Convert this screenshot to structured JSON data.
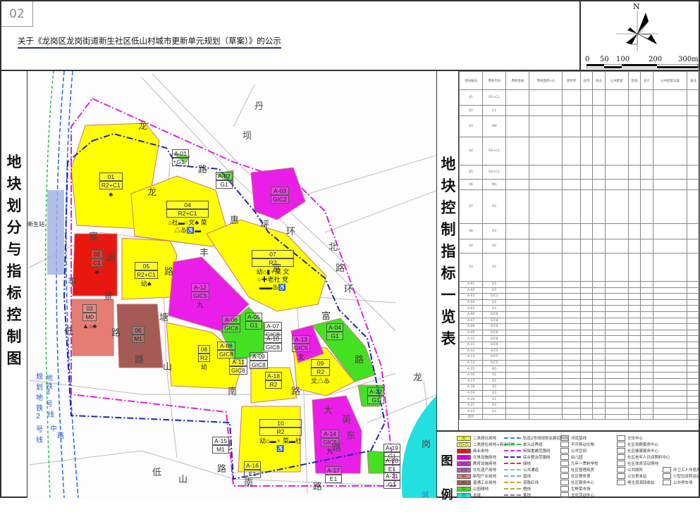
{
  "header": {
    "number": "02",
    "title": "关于《龙岗区龙岗街道新生社区低山村城市更新单元规划（草案）》的公示"
  },
  "compass": {
    "north": "N",
    "scale": [
      "0",
      "50",
      "100",
      "200",
      "300m"
    ]
  },
  "map": {
    "side_title": [
      "地",
      "块",
      "划",
      "分",
      "与",
      "指",
      "标",
      "控",
      "制",
      "图"
    ],
    "station": "新生站",
    "metro_labels": [
      "规",
      "划",
      "地",
      "铁",
      "2",
      "号",
      "线"
    ],
    "roads": [
      {
        "t": "丹"
      },
      {
        "t": "坝"
      },
      {
        "t": "龙"
      },
      {
        "t": "路"
      },
      {
        "t": "龙"
      },
      {
        "t": "惠"
      },
      {
        "t": "坪"
      },
      {
        "t": "富"
      },
      {
        "t": "源"
      },
      {
        "t": "环"
      },
      {
        "t": "北"
      },
      {
        "t": "富"
      },
      {
        "t": "路"
      },
      {
        "t": "丰"
      },
      {
        "t": "路"
      },
      {
        "t": "平"
      },
      {
        "t": "景"
      },
      {
        "t": "路"
      },
      {
        "t": "塘"
      },
      {
        "t": "路"
      },
      {
        "t": "环"
      },
      {
        "t": "富"
      },
      {
        "t": "路"
      },
      {
        "t": "低"
      },
      {
        "t": "山"
      },
      {
        "t": "南"
      },
      {
        "t": "路"
      },
      {
        "t": "大"
      },
      {
        "t": "英"
      },
      {
        "t": "东"
      },
      {
        "t": "路"
      },
      {
        "t": "路"
      },
      {
        "t": "低"
      },
      {
        "t": "山"
      },
      {
        "t": "南"
      },
      {
        "t": "路"
      },
      {
        "t": "龙"
      },
      {
        "t": "岗"
      },
      {
        "t": "河"
      },
      {
        "t": "地"
      },
      {
        "t": "铁"
      },
      {
        "t": "3"
      },
      {
        "t": "号"
      },
      {
        "t": "线"
      },
      {
        "t": "中"
      },
      {
        "t": "路"
      }
    ],
    "parcels": [
      {
        "id": "01",
        "code": "R2+C1",
        "fac": "♣"
      },
      {
        "id": "02",
        "code": "C1",
        "fac": "♣"
      },
      {
        "id": "03",
        "code": "M0",
        "fac": "▲⌂♣"
      },
      {
        "id": "04",
        "code": "R2+C1",
        "fac": "⌂社▬○文♣ 菜△♨♿▬"
      },
      {
        "id": "05",
        "code": "R2+C1",
        "fac": "幼♣"
      },
      {
        "id": "06",
        "code": "M1",
        "fac": ""
      },
      {
        "id": "07",
        "code": "R2",
        "fac": "幼⌂▮♆菜 文○✚老社 党▬▬♨♿"
      },
      {
        "id": "08",
        "code": "R2",
        "fac": "幼"
      },
      {
        "id": "09",
        "code": "R2",
        "fac": "文△♨"
      },
      {
        "id": "10",
        "code": "R2",
        "fac": "幼⌂▬♆ 菜▬社♿"
      },
      {
        "id": "A-01",
        "code": "G1"
      },
      {
        "id": "A-02",
        "code": "G1"
      },
      {
        "id": "A-03",
        "code": "GIC2"
      },
      {
        "id": "A-04",
        "code": "G1"
      },
      {
        "id": "A-05",
        "code": "G1"
      },
      {
        "id": "A-06",
        "code": "GIC8"
      },
      {
        "id": "A-07",
        "code": "GIC8"
      },
      {
        "id": "A-08",
        "code": "GIC8"
      },
      {
        "id": "A-09",
        "code": "GIC8"
      },
      {
        "id": "A-10",
        "code": "GIC8"
      },
      {
        "id": "A-11",
        "code": "GIC8"
      },
      {
        "id": "A-12",
        "code": "GIC5",
        "fac": "九"
      },
      {
        "id": "A-13",
        "code": "GIC5",
        "fac": "文"
      },
      {
        "id": "A-14",
        "code": "GIC5",
        "fac": "九"
      },
      {
        "id": "A-15",
        "code": "M1"
      },
      {
        "id": "A-16",
        "code": "E1"
      },
      {
        "id": "A-17",
        "code": "E1"
      },
      {
        "id": "A-18",
        "code": "R2"
      },
      {
        "id": "A-19",
        "code": "G1"
      },
      {
        "id": "A-20",
        "code": "E1"
      },
      {
        "id": "A-21",
        "code": "G1"
      },
      {
        "id": "A-22",
        "code": "G1"
      }
    ]
  },
  "table": {
    "side_title": [
      "地",
      "块",
      "控",
      "制",
      "指",
      "标",
      "一",
      "览",
      "表"
    ],
    "headers": [
      "地块编号",
      "用地代码",
      "用地性质",
      "用地面积(㎡)",
      "容积率",
      "住宅",
      "商业",
      "公共配套",
      "其他",
      "总计",
      "公共配套设施",
      "备注"
    ],
    "total_label": "合计"
  },
  "legend": {
    "title": [
      "图",
      "例"
    ],
    "landuse": [
      {
        "code": "R2",
        "label": "二类居住用地",
        "color": "#ffff00"
      },
      {
        "code": "R2+C1",
        "label": "二类居住用地+商业用地",
        "color": "#ffff66"
      },
      {
        "code": "C1",
        "label": "商业用地",
        "color": "#e31a1c"
      },
      {
        "code": "GIC2",
        "label": "文体设施用地",
        "color": "#e600e6"
      },
      {
        "code": "GIC5",
        "label": "教育设施用地",
        "color": "#cc33cc"
      },
      {
        "code": "GIC8",
        "label": "文化遗产用地",
        "color": "#b366cc"
      },
      {
        "code": "M0",
        "label": "新型产业用地",
        "color": "#e8827a"
      },
      {
        "code": "M1",
        "label": "普通工业用地",
        "color": "#a8615a"
      },
      {
        "code": "G1",
        "label": "公园绿地",
        "color": "#44dd22"
      },
      {
        "code": "E1",
        "label": "水域",
        "color": "#22dddd"
      }
    ],
    "lines": [
      "轨道2号线规划走廊控制线",
      "单元边界线",
      "拆除重建范围线",
      "综合整治范围线",
      "绿线",
      "公共通道",
      "蓝线",
      "道路红线",
      "橙线",
      "紫线"
    ],
    "facilities": [
      "河道蓝线",
      "不可移动文物",
      "公共空间",
      "幼儿园",
      "九年一贯制学校",
      "社区管理用房",
      "社区警务室",
      "社区服务中心",
      "生鲜菜市场",
      "文化活动中心"
    ],
    "facilities2": [
      "文化中心",
      "社区党群服务中心",
      "社区健康服务中心",
      "社区老年人日间照料中心",
      "社区体育活动场地",
      "公共厕所",
      "公交首末站",
      "再生资源回收站",
      "环卫工人作息房",
      "小型垃圾转运站",
      "公共停车场"
    ]
  }
}
